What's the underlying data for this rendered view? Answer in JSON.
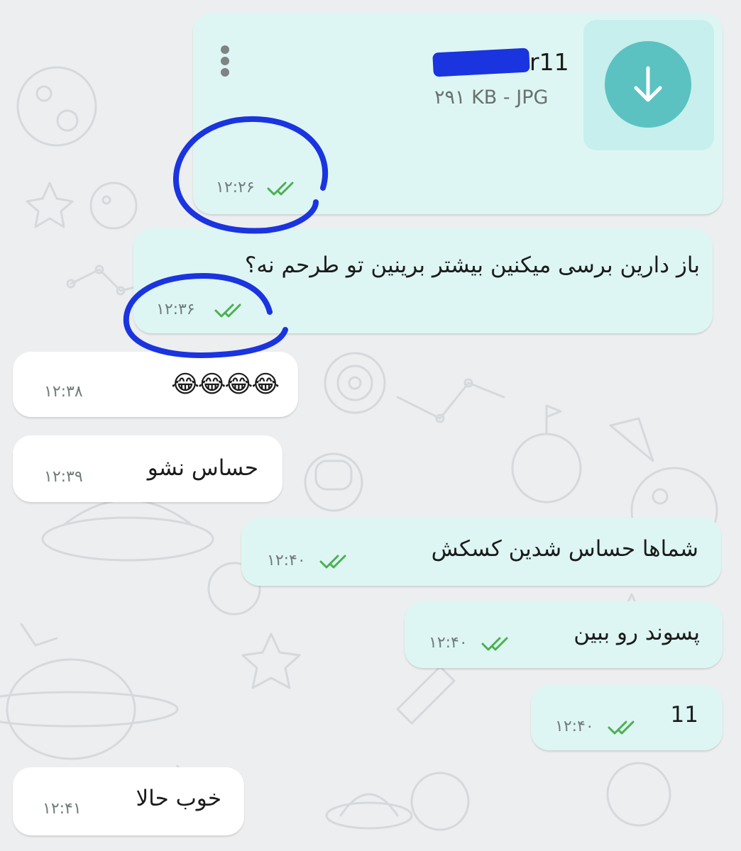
{
  "theme": {
    "outgoing_bubble": "#ddf6f4",
    "incoming_bubble": "#ffffff",
    "accent": "#5bc2c1",
    "annotation": "#1a34e0",
    "tick": "#4caf50"
  },
  "file_message": {
    "file_name_suffix": "r11",
    "file_meta": "۲۹۱ KB - JPG",
    "time": "۱۲:۲۶",
    "status": "read",
    "icons": {
      "menu": "more-vertical-icon",
      "download": "download-arrow-icon"
    }
  },
  "messages": [
    {
      "direction": "out",
      "text": "باز دارین برسی میکنین بیشتر برینین تو طرحم نه؟",
      "time": "۱۲:۳۶",
      "status": "read"
    },
    {
      "direction": "in",
      "text": "😂😂😂😂",
      "time": "۱۲:۳۸"
    },
    {
      "direction": "in",
      "text": "حساس نشو",
      "time": "۱۲:۳۹"
    },
    {
      "direction": "out",
      "text": "شماها حساس شدین کسکش",
      "time": "۱۲:۴۰",
      "status": "read"
    },
    {
      "direction": "out",
      "text": "پسوند رو ببین",
      "time": "۱۲:۴۰",
      "status": "read"
    },
    {
      "direction": "out",
      "text": "11",
      "time": "۱۲:۴۰",
      "status": "read"
    },
    {
      "direction": "in",
      "text": "خوب حالا",
      "time": "۱۲:۴۱"
    }
  ]
}
